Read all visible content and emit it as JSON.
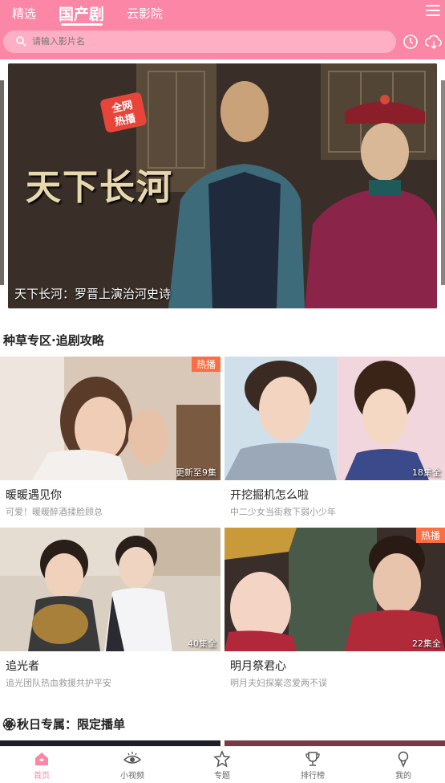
{
  "header": {
    "tabs": [
      {
        "label": "精选"
      },
      {
        "label": "国产剧"
      },
      {
        "label": "云影院"
      }
    ],
    "search_placeholder": "请输入影片名"
  },
  "banner": {
    "badge_line1": "全网",
    "badge_line2": "热播",
    "calligraphy": "天下长河",
    "caption": "天下长河：罗晋上演治河史诗"
  },
  "section1": {
    "title": "种草专区·追剧攻略",
    "cards": [
      {
        "title": "暖暖遇见你",
        "desc": "可爱！暖暖醉酒揉脸顾总",
        "badge": "热播",
        "eps": "更新至9集"
      },
      {
        "title": "开挖掘机怎么啦",
        "desc": "中二少女当街救下弱小少年",
        "badge": "",
        "eps": "18集全"
      },
      {
        "title": "追光者",
        "desc": "追光团队热血救援共护平安",
        "badge": "",
        "eps": "40集全"
      },
      {
        "title": "明月祭君心",
        "desc": "明月夫妇探案恣爱两不误",
        "badge": "热播",
        "eps": "22集全"
      }
    ]
  },
  "section2": {
    "title": "🏵秋日专属：限定播单"
  },
  "bottom_nav": [
    {
      "label": "首页",
      "icon": "home-icon"
    },
    {
      "label": "小视频",
      "icon": "eye-icon"
    },
    {
      "label": "专题",
      "icon": "star-icon"
    },
    {
      "label": "排行榜",
      "icon": "trophy-icon"
    },
    {
      "label": "我的",
      "icon": "user-icon"
    }
  ],
  "colors": {
    "accent": "#fc86a6",
    "badge": "#fc6e41"
  }
}
